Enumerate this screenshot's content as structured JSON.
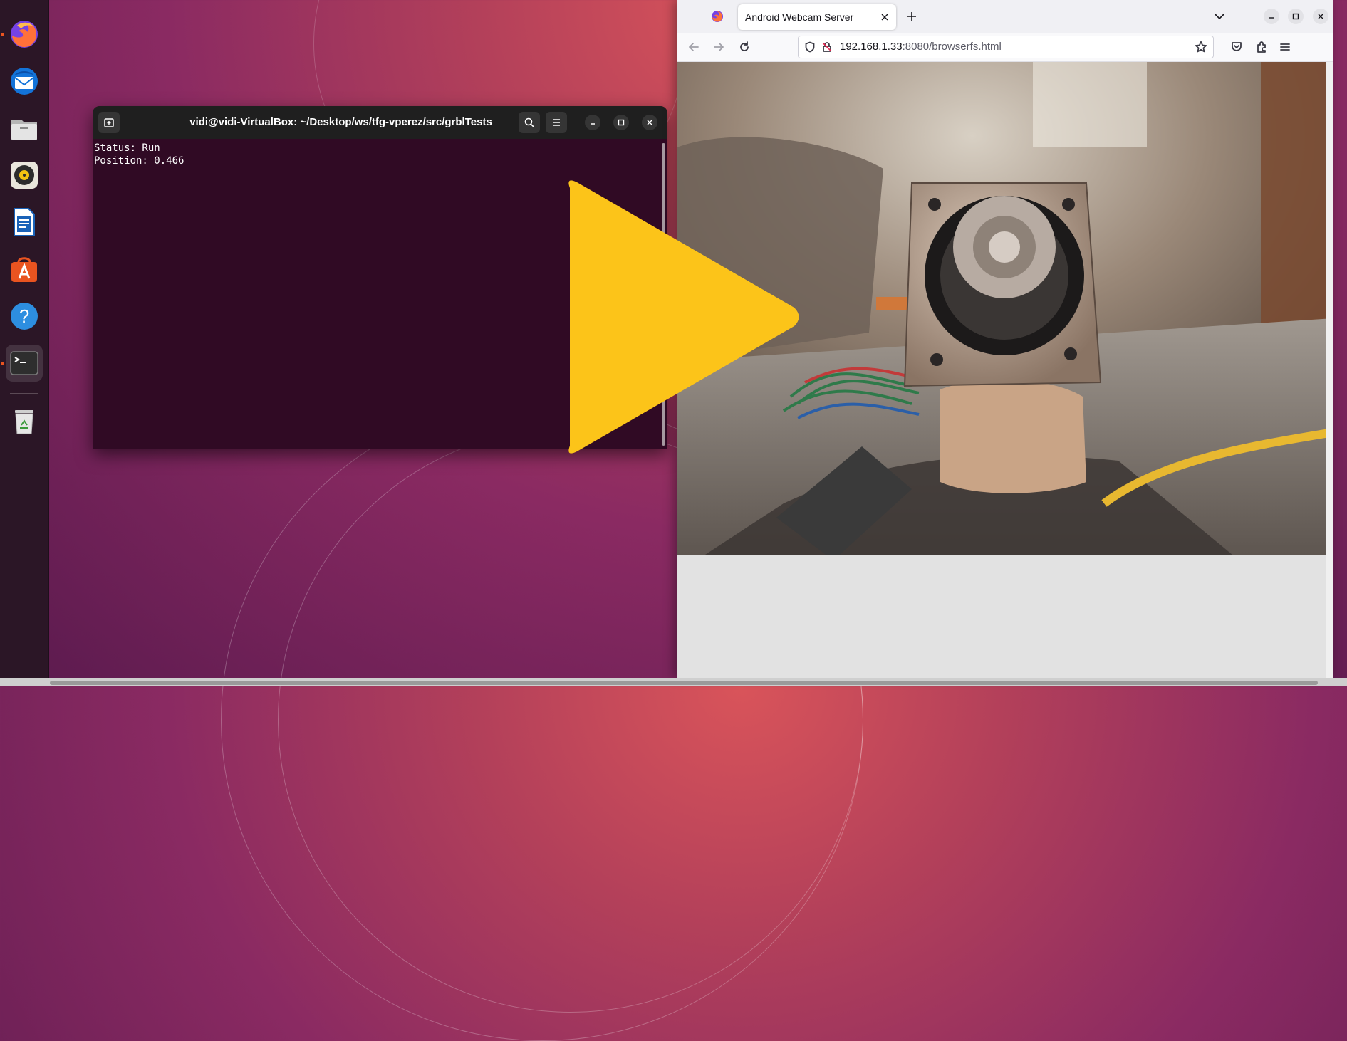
{
  "dock": {
    "items": [
      {
        "name": "firefox-icon",
        "label": "Firefox"
      },
      {
        "name": "thunderbird-icon",
        "label": "Thunderbird"
      },
      {
        "name": "files-icon",
        "label": "Files"
      },
      {
        "name": "rhythmbox-icon",
        "label": "Rhythmbox"
      },
      {
        "name": "libreoffice-writer-icon",
        "label": "LibreOffice Writer"
      },
      {
        "name": "app-center-icon",
        "label": "Ubuntu Software"
      },
      {
        "name": "help-icon",
        "label": "Help"
      },
      {
        "name": "terminal-icon",
        "label": "Terminal"
      },
      {
        "name": "trash-icon",
        "label": "Trash"
      }
    ],
    "accent": "#e95420"
  },
  "terminal": {
    "title": "vidi@vidi-VirtualBox: ~/Desktop/ws/tfg-vperez/src/grblTests",
    "lines": [
      "Status: Run",
      "Position: 0.466"
    ],
    "background": "#300a24",
    "header_background": "#1f1f1f"
  },
  "browser": {
    "tab_title": "Android Webcam Server",
    "url_host": "192.168.1.33",
    "url_rest": ":8080/browserfs.html",
    "icons": [
      "back-icon",
      "forward-icon",
      "reload-icon",
      "shield-icon",
      "insecure-lock-icon",
      "bookmark-star-icon",
      "pocket-icon",
      "extensions-icon",
      "menu-icon"
    ]
  },
  "overlay": {
    "play_color": "#fcc419"
  }
}
